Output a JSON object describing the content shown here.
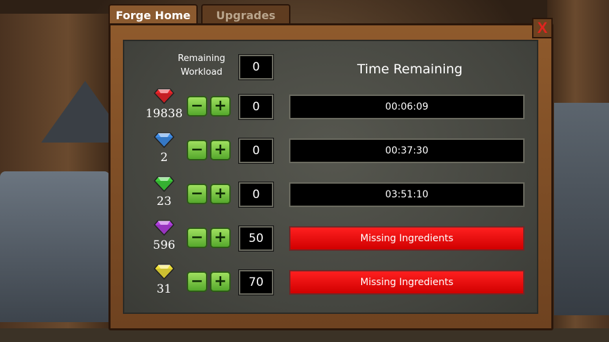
{
  "tabs": [
    {
      "label": "Forge Home",
      "active": true
    },
    {
      "label": "Upgrades",
      "active": false
    }
  ],
  "close_label": "X",
  "header": {
    "workload_label_line1": "Remaining",
    "workload_label_line2": "Workload",
    "workload_value": "0",
    "time_title": "Time Remaining"
  },
  "rows": [
    {
      "gem": "red-gem-icon",
      "color": "#e8252a",
      "count": "19838",
      "quantity": "0",
      "status": "00:06:09",
      "status_type": "timer"
    },
    {
      "gem": "blue-gem-icon",
      "color": "#3f8de8",
      "count": "2",
      "quantity": "0",
      "status": "00:37:30",
      "status_type": "timer"
    },
    {
      "gem": "green-gem-icon",
      "color": "#3fcf3a",
      "count": "23",
      "quantity": "0",
      "status": "03:51:10",
      "status_type": "timer"
    },
    {
      "gem": "purple-gem-icon",
      "color": "#b23fe0",
      "count": "596",
      "quantity": "50",
      "status": "Missing Ingredients",
      "status_type": "missing"
    },
    {
      "gem": "yellow-gem-icon",
      "color": "#f1e23a",
      "count": "31",
      "quantity": "70",
      "status": "Missing Ingredients",
      "status_type": "missing"
    }
  ],
  "stepper": {
    "minus": "−",
    "plus": "+"
  },
  "colors": {
    "frame": "#8f5a2c",
    "panel": "#4c4d46",
    "missing": "#e00000",
    "stepper": "#7cc845"
  }
}
